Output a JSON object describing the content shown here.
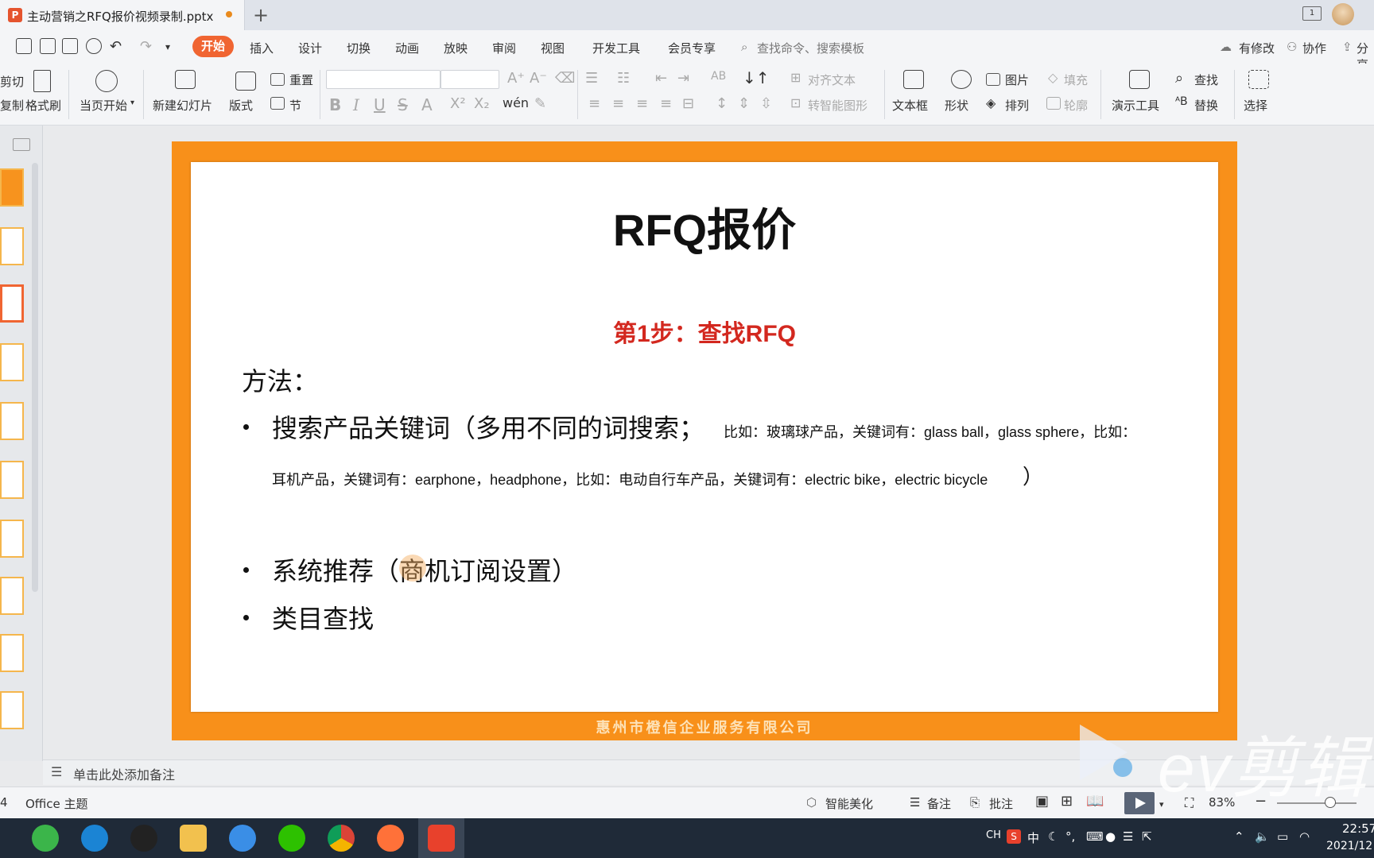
{
  "window": {
    "tab_title": "主动营销之RFQ报价视频录制.pptx",
    "app_icon_letter": "P",
    "new_tab": "+",
    "window_icon_number": "1"
  },
  "menu": {
    "items": [
      "开始",
      "插入",
      "设计",
      "切换",
      "动画",
      "放映",
      "审阅",
      "视图",
      "开发工具",
      "会员专享"
    ],
    "search_placeholder": "查找命令、搜索模板",
    "right": [
      "有修改",
      "协作",
      "分享"
    ]
  },
  "ribbon": {
    "cut": "剪切",
    "copy": "复制",
    "format_painter": "格式刷",
    "play_from_current": "当页开始",
    "new_slide": "新建幻灯片",
    "layout": "版式",
    "reset": "重置",
    "section": "节",
    "align_text": "对齐文本",
    "to_smartart": "转智能图形",
    "textbox": "文本框",
    "shape": "形状",
    "picture": "图片",
    "fill": "填充",
    "arrange": "排列",
    "outline": "轮廓",
    "presentation_tools": "演示工具",
    "find": "查找",
    "replace": "替换",
    "select": "选择"
  },
  "slide": {
    "title": "RFQ报价",
    "step": "第1步：查找RFQ",
    "method": "方法：",
    "bullet1_big": "搜索产品关键词（多用不同的词搜索；",
    "bullet1_line1": "比如：玻璃球产品，关键词有：glass ball，glass sphere，比如：",
    "bullet1_line2": "耳机产品，关键词有：earphone，headphone，比如：电动自行车产品，关键词有：electric bike，electric bicycle",
    "bullet1_close": "）",
    "bullet2": "系统推荐（商机订阅设置）",
    "bullet3": "类目查找",
    "footer": "惠州市橙信企业服务有限公司"
  },
  "notes": {
    "placeholder": "单击此处添加备注"
  },
  "statusbar": {
    "slide_no": "4",
    "theme": "Office 主题",
    "beautify": "智能美化",
    "notes": "备注",
    "comments": "批注",
    "zoom": "83%"
  },
  "watermark": {
    "text": "ev剪辑"
  },
  "taskbar": {
    "tray_ch": "CH",
    "tray_s": "S",
    "tray_zh": "中",
    "time": "22:57",
    "date": "2021/12"
  },
  "colors": {
    "accent": "#f06532",
    "slide_frame": "#f8901a",
    "step_red": "#d3281f"
  }
}
